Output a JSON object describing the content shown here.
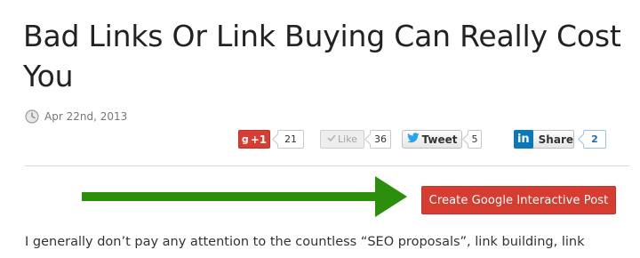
{
  "post": {
    "title": "Bad Links Or Link Buying Can Really Cost You",
    "date": "Apr 22nd, 2013",
    "body_start": "I generally don’t pay any attention to the countless “SEO proposals”, link building, link"
  },
  "share": {
    "gplus": {
      "label": "+1",
      "count": "21",
      "icon": "google-plus-icon",
      "color": "#d73d32"
    },
    "facebook": {
      "label": "Like",
      "count": "36",
      "icon": "thumbs-up-icon"
    },
    "twitter": {
      "label": "Tweet",
      "count": "5",
      "icon": "twitter-bird-icon",
      "color": "#2aa3ef"
    },
    "linkedin": {
      "label": "Share",
      "count": "2",
      "icon": "linkedin-icon",
      "color": "#0b78b7"
    }
  },
  "cta": {
    "label": "Create Google Interactive Post",
    "color": "#d63d30"
  },
  "annotation": {
    "arrow_color": "#2c8f0c",
    "icon": "arrow-right-icon"
  }
}
